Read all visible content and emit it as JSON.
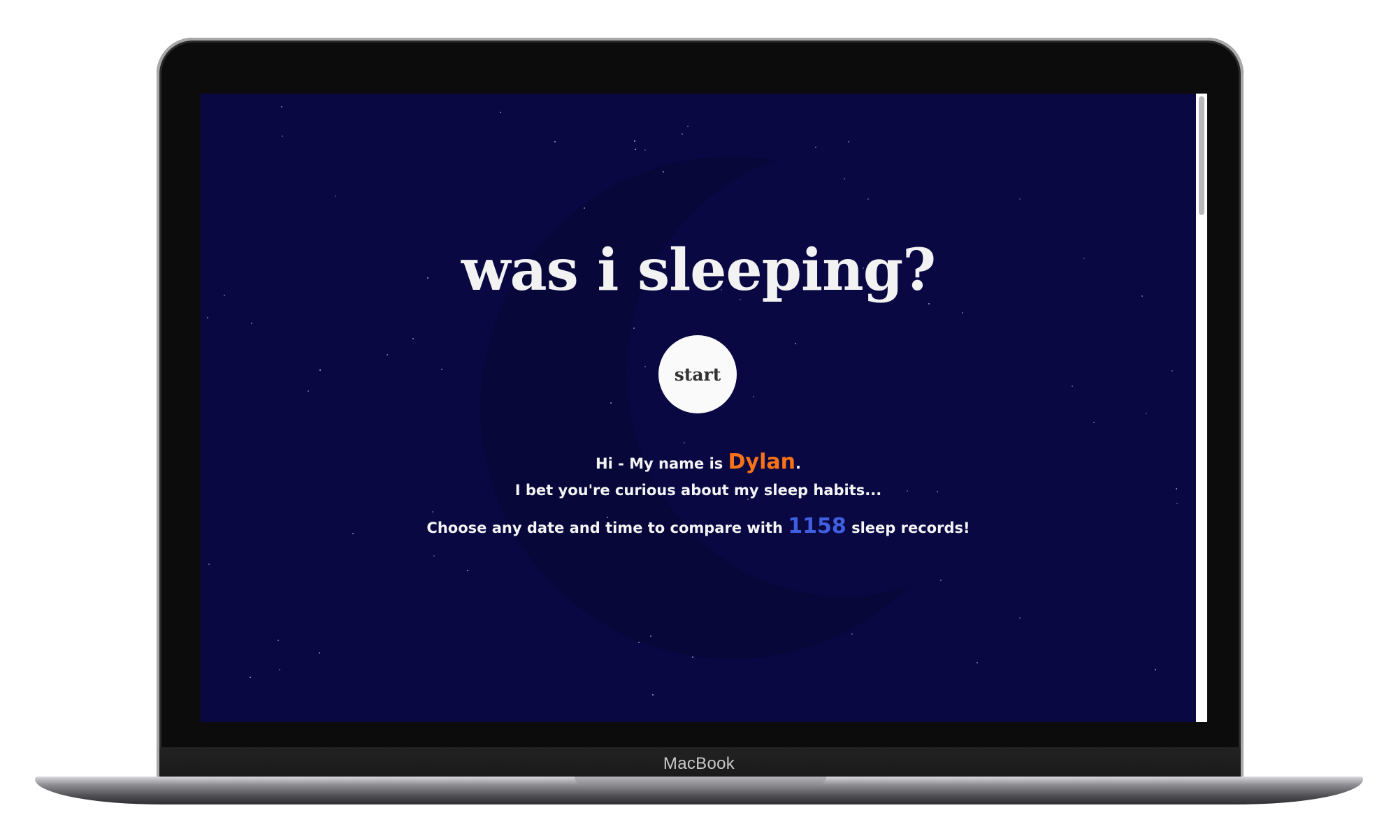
{
  "device": {
    "brand_label": "MacBook"
  },
  "page": {
    "title": "was i sleeping?",
    "start_button": "start",
    "intro": {
      "greeting_prefix": "Hi - My name is ",
      "name": "Dylan",
      "greeting_suffix": ".",
      "curious_line": "I bet you're curious about my sleep habits...",
      "choose_prefix": "Choose any date and time to compare with ",
      "record_count": "1158",
      "choose_suffix": " sleep records!"
    }
  },
  "colors": {
    "background": "#090843",
    "moon": "#07073a",
    "name_accent": "#f97316",
    "count_accent": "#3f5fe0",
    "text": "#f4f4f4"
  }
}
